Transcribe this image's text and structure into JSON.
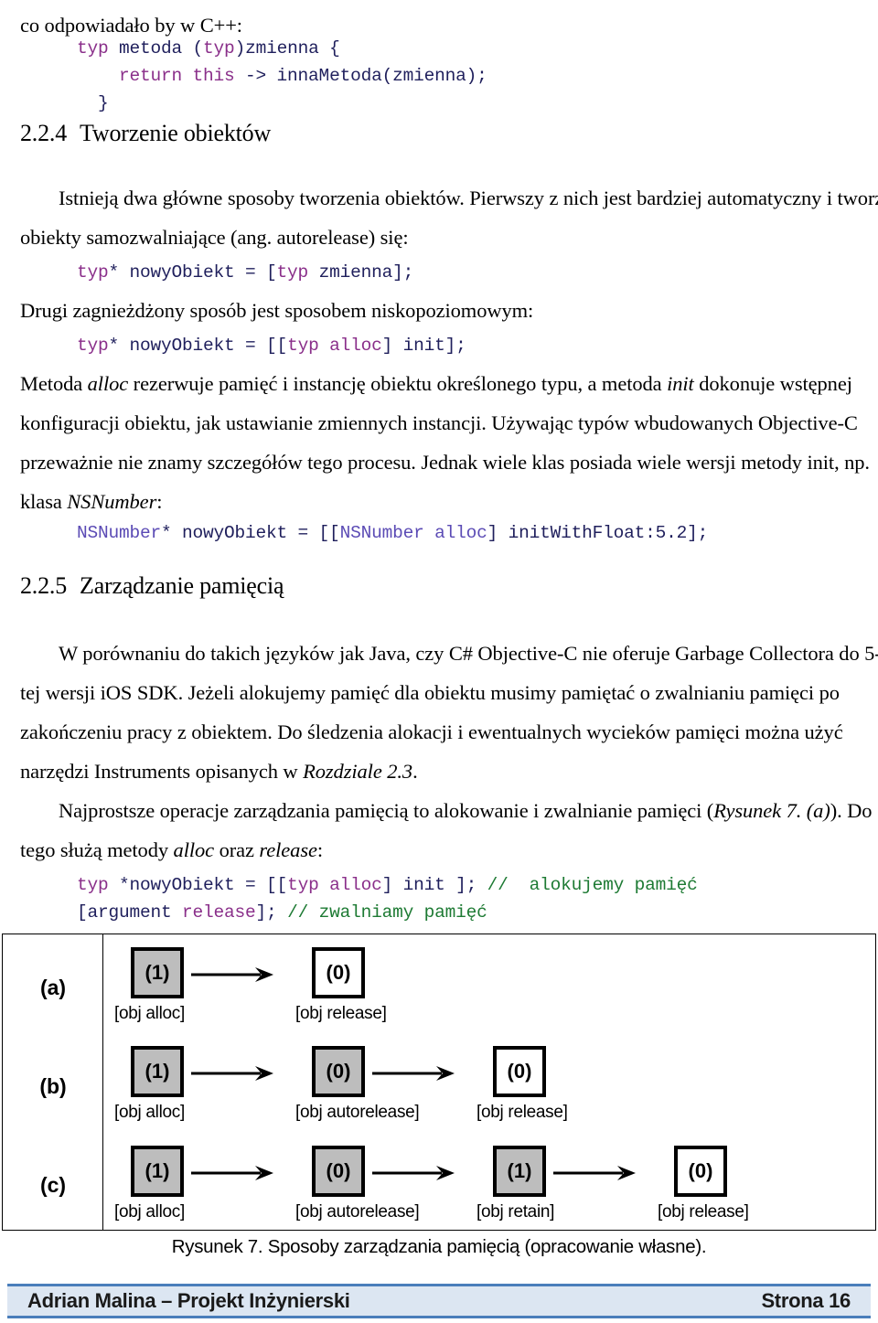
{
  "document": {
    "intro_line": "co odpowiadało by w C++:",
    "code_block_1": [
      [
        {
          "t": "typ",
          "c": "kw"
        },
        {
          "t": " metoda (",
          "c": "plain"
        },
        {
          "t": "typ",
          "c": "kw"
        },
        {
          "t": ")zmienna {",
          "c": "plain"
        }
      ],
      [
        {
          "t": "    ",
          "c": "plain"
        },
        {
          "t": "return this",
          "c": "kw"
        },
        {
          "t": " -> innaMetoda(zmienna);",
          "c": "plain"
        }
      ],
      [
        {
          "t": "  }",
          "c": "plain"
        }
      ]
    ],
    "heading_1": {
      "number": "2.2.4",
      "title": "Tworzenie obiektów"
    },
    "para_1": "Istnieją dwa główne sposoby tworzenia obiektów. Pierwszy z nich jest bardziej automatyczny i tworzy obiekty samozwalniające (ang. autorelease) się:",
    "code_block_2": [
      [
        {
          "t": "typ",
          "c": "kw"
        },
        {
          "t": "* nowyObiekt = [",
          "c": "plain"
        },
        {
          "t": "typ",
          "c": "kw"
        },
        {
          "t": " zmienna];",
          "c": "plain"
        }
      ]
    ],
    "para_2": "Drugi zagnieżdżony sposób jest sposobem niskopoziomowym:",
    "code_block_3": [
      [
        {
          "t": "typ",
          "c": "kw"
        },
        {
          "t": "* nowyObiekt = [[",
          "c": "plain"
        },
        {
          "t": "typ alloc",
          "c": "kw"
        },
        {
          "t": "] init];",
          "c": "plain"
        }
      ]
    ],
    "para_3_runs": [
      {
        "t": "Metoda ",
        "i": false
      },
      {
        "t": "alloc",
        "i": true
      },
      {
        "t": " rezerwuje pamięć i instancję obiektu określonego typu, a metoda ",
        "i": false
      },
      {
        "t": "init",
        "i": true
      },
      {
        "t": " dokonuje wstępnej konfiguracji obiektu, jak ustawianie zmiennych instancji. Używając typów wbudowanych Objective-C przeważnie nie znamy szczegółów tego procesu. Jednak wiele klas posiada wiele wersji metody init, np. klasa ",
        "i": false
      },
      {
        "t": "NSNumber",
        "i": true
      },
      {
        "t": ":",
        "i": false
      }
    ],
    "code_block_4": [
      [
        {
          "t": "NSNumber",
          "c": "typ2"
        },
        {
          "t": "* nowyObiekt = [[",
          "c": "plain"
        },
        {
          "t": "NSNumber alloc",
          "c": "typ2"
        },
        {
          "t": "] initWithFloat:5.2];",
          "c": "plain"
        }
      ]
    ],
    "heading_2": {
      "number": "2.2.5",
      "title": "Zarządzanie pamięcią"
    },
    "para_4": "W porównaniu do takich języków jak Java, czy C# Objective-C nie oferuje Garbage Collectora do 5-tej wersji iOS SDK. Jeżeli alokujemy pamięć dla obiektu musimy pamiętać o zwalnianiu pamięci po zakończeniu pracy z obiektem. Do śledzenia alokacji i ewentualnych wycieków pamięci można użyć narzędzi Instruments opisanych w ",
    "para_4_tail_italic": "Rozdziale 2.3",
    "para_4_tail": ".",
    "para_5_runs": [
      {
        "t": "Najprostsze operacje zarządzania pamięcią to alokowanie i zwalnianie pamięci (",
        "i": false
      },
      {
        "t": "Rysunek 7. (a)",
        "i": true
      },
      {
        "t": "). Do tego służą metody ",
        "i": false
      },
      {
        "t": "alloc",
        "i": true
      },
      {
        "t": " oraz ",
        "i": false
      },
      {
        "t": "release",
        "i": true
      },
      {
        "t": ":",
        "i": false
      }
    ],
    "code_block_5": [
      [
        {
          "t": "typ",
          "c": "kw"
        },
        {
          "t": " *nowyObiekt = [[",
          "c": "plain"
        },
        {
          "t": "typ alloc",
          "c": "kw"
        },
        {
          "t": "] init ]; ",
          "c": "plain"
        },
        {
          "t": "//  alokujemy pamięć",
          "c": "cmt"
        }
      ],
      [
        {
          "t": "[argument ",
          "c": "plain"
        },
        {
          "t": "release",
          "c": "kw"
        },
        {
          "t": "]; ",
          "c": "plain"
        },
        {
          "t": "// zwalniamy pamięć",
          "c": "cmt"
        }
      ]
    ]
  },
  "figure": {
    "caption": "Rysunek 7. Sposoby zarządzania pamięcią (opracowanie własne).",
    "row_labels": [
      "(a)",
      "(b)",
      "(c)"
    ],
    "rows": [
      {
        "label": "(a)",
        "nodes": [
          {
            "value": "(1)",
            "caption": "[obj  alloc]",
            "filled": true
          },
          {
            "value": "(0)",
            "caption": "[obj release]",
            "filled": false
          }
        ]
      },
      {
        "label": "(b)",
        "nodes": [
          {
            "value": "(1)",
            "caption": "[obj  alloc]",
            "filled": true
          },
          {
            "value": "(0)",
            "caption": "[obj autorelease]",
            "filled": true
          },
          {
            "value": "(0)",
            "caption": "[obj release]",
            "filled": false
          }
        ]
      },
      {
        "label": "(c)",
        "nodes": [
          {
            "value": "(1)",
            "caption": "[obj  alloc]",
            "filled": true
          },
          {
            "value": "(0)",
            "caption": "[obj autorelease]",
            "filled": true
          },
          {
            "value": "(1)",
            "caption": "[obj retain]",
            "filled": true
          },
          {
            "value": "(0)",
            "caption": "[obj release]",
            "filled": false
          }
        ]
      }
    ]
  },
  "footer": {
    "left": "Adrian Malina – Projekt Inżynierski",
    "right": "Strona 16",
    "background": "#dce6f2",
    "rule_color": "#4a7ebb"
  },
  "colors": {
    "code_default": "#1f1f5c",
    "code_keyword": "#8a2f8a",
    "code_type": "#5b4bb5",
    "code_comment": "#1d7a33",
    "node_fill": "#bdbdbd"
  }
}
